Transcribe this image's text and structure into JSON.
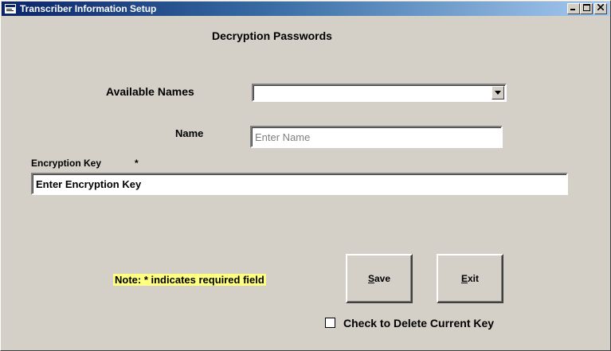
{
  "window": {
    "title": "Transcriber Information Setup",
    "icon": "app-window-icon",
    "controls": {
      "minimize": "_",
      "maximize": "□",
      "close": "X"
    }
  },
  "form": {
    "heading": "Decryption Passwords",
    "available_names_label": "Available Names",
    "available_names_value": "",
    "name_label": "Name",
    "name_placeholder": "Enter Name",
    "encryption_key_label": "Encryption Key",
    "required_marker": "*",
    "encryption_key_value": "Enter Encryption Key",
    "note": "Note: * indicates required field",
    "save_label": "Save",
    "save_mnemonic": "S",
    "save_rest": "ave",
    "exit_label": "Exit",
    "exit_mnemonic": "E",
    "exit_rest": "xit",
    "delete_checkbox_label": "Check to Delete Current Key",
    "delete_checked": false
  },
  "colors": {
    "face": "#d4d0c8",
    "title_start": "#0a246a",
    "title_end": "#a6caf0",
    "note_highlight": "#ffff80"
  }
}
